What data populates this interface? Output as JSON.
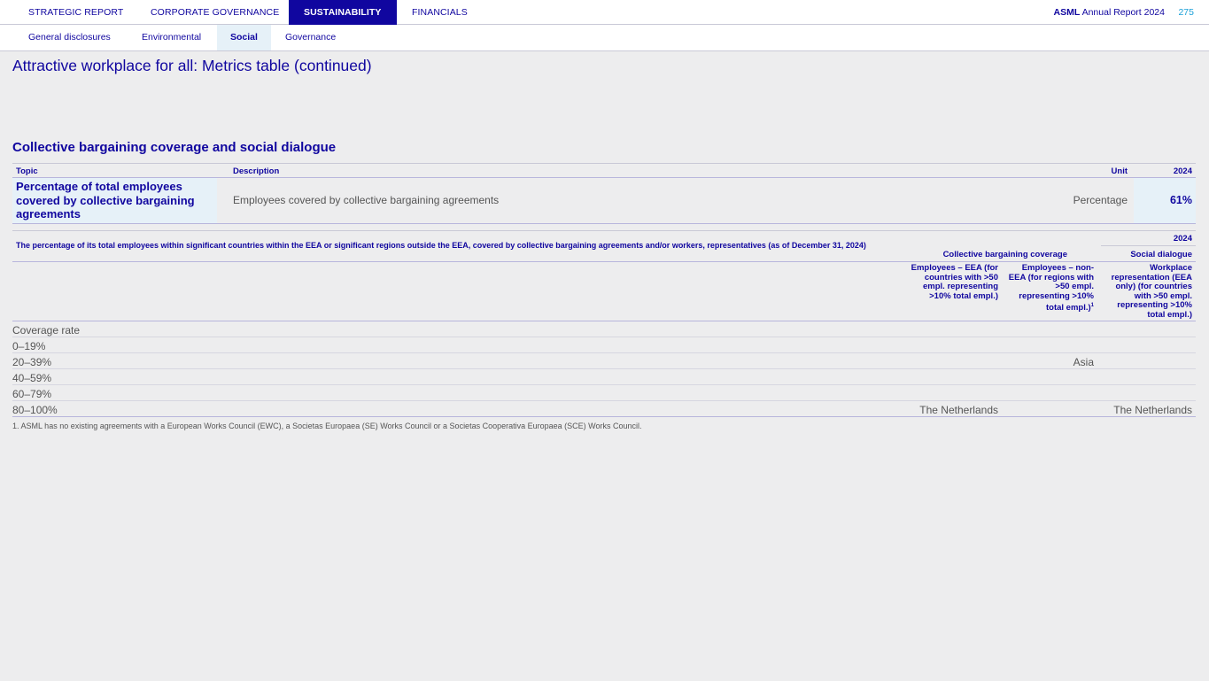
{
  "top_nav": {
    "tabs": [
      {
        "label": "STRATEGIC REPORT"
      },
      {
        "label": "CORPORATE GOVERNANCE"
      },
      {
        "label": "SUSTAINABILITY"
      },
      {
        "label": "FINANCIALS"
      }
    ],
    "brand_bold": "ASML",
    "brand_rest": " Annual Report 2024",
    "page_number": "275"
  },
  "sub_nav": {
    "tabs": [
      {
        "label": "General disclosures"
      },
      {
        "label": "Environmental"
      },
      {
        "label": "Social"
      },
      {
        "label": "Governance"
      }
    ]
  },
  "page_title": "Attractive workplace for all: Metrics table (continued)",
  "section_title": "Collective bargaining coverage and social dialogue",
  "table1": {
    "headers": {
      "topic": "Topic",
      "description": "Description",
      "unit": "Unit",
      "year": "2024"
    },
    "row": {
      "topic": "Percentage of total employees covered by collective bargaining agreements",
      "description": "Employees covered by collective bargaining agreements",
      "unit": "Percentage",
      "value": "61%"
    }
  },
  "table2": {
    "year": "2024",
    "caption": "The percentage of its total employees within significant countries within the EEA or significant regions outside the EEA, covered by collective bargaining agreements and/or workers, representatives (as of December 31, 2024)",
    "group1": "Collective bargaining coverage",
    "group2": "Social dialogue",
    "col1": "Employees – EEA (for countries with >50 empl. representing >10% total empl.)",
    "col2": "Employees – non-EEA (for regions with >50 empl. representing >10% total empl.)",
    "col2_sup": "1",
    "col3": "Workplace representation (EEA only) (for countries with >50 empl. representing >10% total empl.)",
    "rows": [
      {
        "label": "Coverage rate",
        "eea": "",
        "non_eea": "",
        "workplace": ""
      },
      {
        "label": "0–19%",
        "eea": "",
        "non_eea": "",
        "workplace": ""
      },
      {
        "label": "20–39%",
        "eea": "",
        "non_eea": "Asia",
        "workplace": ""
      },
      {
        "label": "40–59%",
        "eea": "",
        "non_eea": "",
        "workplace": ""
      },
      {
        "label": "60–79%",
        "eea": "",
        "non_eea": "",
        "workplace": ""
      },
      {
        "label": "80–100%",
        "eea": "The Netherlands",
        "non_eea": "",
        "workplace": "The Netherlands"
      }
    ]
  },
  "footnote": "1. ASML has no existing agreements with a European Works Council (EWC), a Societas Europaea (SE) Works Council or a Societas Cooperativa Europaea (SCE) Works Council."
}
